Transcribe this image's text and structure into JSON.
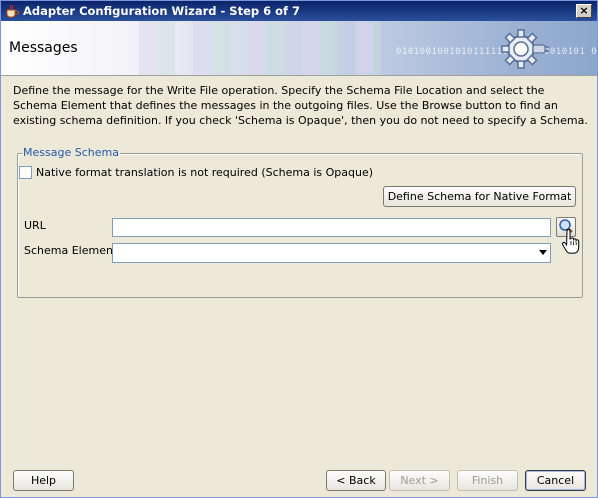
{
  "window": {
    "title": "Adapter Configuration Wizard - Step 6 of 7",
    "close_label": "×"
  },
  "banner": {
    "heading": "Messages",
    "binary_text": "0101001001010111110101 010010101 0101"
  },
  "description": "Define the message for the Write File operation.  Specify the Schema File Location and select the Schema Element that defines the messages in the outgoing files. Use the Browse button to find an existing schema definition. If you check 'Schema is Opaque', then you do not need to specify a Schema.",
  "message_schema": {
    "legend": "Message Schema",
    "opaque_checkbox_label": "Native format translation is not required (Schema is Opaque)",
    "opaque_checked": false,
    "define_schema_button": "Define Schema for Native Format",
    "url_label": "URL",
    "url_value": "",
    "schema_element_label": "Schema Element",
    "schema_element_value": ""
  },
  "footer": {
    "help": "Help",
    "back": "< Back",
    "next": "Next >",
    "finish": "Finish",
    "cancel": "Cancel"
  },
  "colors": {
    "titlebar": "#0a246a",
    "legend": "#2457a8",
    "dialog_bg": "#ece9d8"
  }
}
